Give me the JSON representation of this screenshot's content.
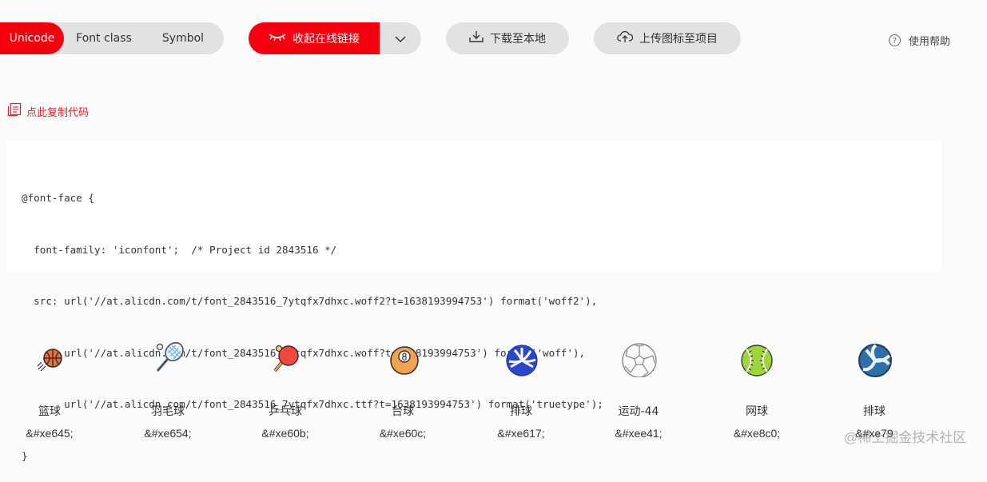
{
  "tabs": [
    {
      "label": "Unicode",
      "active": true
    },
    {
      "label": "Font class",
      "active": false
    },
    {
      "label": "Symbol",
      "active": false
    }
  ],
  "toolbar": {
    "collapse_label": "收起在线链接",
    "download_label": "下载至本地",
    "upload_label": "上传图标至项目",
    "help_label": "使用帮助"
  },
  "copy_label": "点此复制代码",
  "code_lines": [
    "@font-face {",
    "  font-family: 'iconfont';  /* Project id 2843516 */",
    "  src: url('//at.alicdn.com/t/font_2843516_7ytqfx7dhxc.woff2?t=1638193994753') format('woff2'),",
    "       url('//at.alicdn.com/t/font_2843516_7ytqfx7dhxc.woff?t=1638193994753') format('woff'),",
    "       url('//at.alicdn.com/t/font_2843516_7ytqfx7dhxc.ttf?t=1638193994753') format('truetype');",
    "}"
  ],
  "icons": [
    {
      "name": "篮球",
      "code": "&#xe645;",
      "icon": "basketball-icon"
    },
    {
      "name": "羽毛球",
      "code": "&#xe654;",
      "icon": "badminton-racket-icon"
    },
    {
      "name": "乒乓球",
      "code": "&#xe60b;",
      "icon": "ping-pong-icon"
    },
    {
      "name": "台球",
      "code": "&#xe60c;",
      "icon": "billiard-ball-icon"
    },
    {
      "name": "排球",
      "code": "&#xe617;",
      "icon": "volleyball-icon"
    },
    {
      "name": "运动-44",
      "code": "&#xee41;",
      "icon": "soccer-ball-icon"
    },
    {
      "name": "网球",
      "code": "&#xe8c0;",
      "icon": "tennis-ball-icon"
    },
    {
      "name": "排球",
      "code": "&#xe79",
      "icon": "volleyball-icon"
    }
  ],
  "watermark": "@稀土掘金技术社区",
  "colors": {
    "accent": "#f4000e",
    "button_gray": "#e2e2e2",
    "link_red": "#e0202e"
  }
}
